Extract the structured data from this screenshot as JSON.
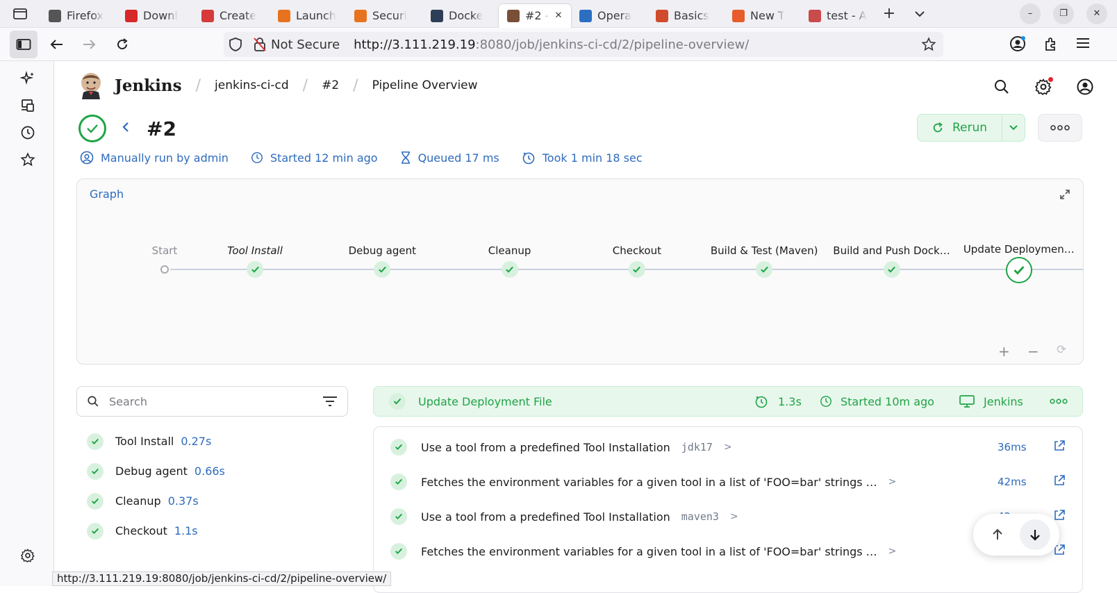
{
  "browser": {
    "tabs": [
      {
        "label": "Firefox",
        "icon": "firefox-view-icon",
        "color": "#555"
      },
      {
        "label": "Downl",
        "icon": "download-icon",
        "color": "#d62828"
      },
      {
        "label": "Create",
        "icon": "create-icon",
        "color": "#d63a3a"
      },
      {
        "label": "Launch",
        "icon": "aws-icon",
        "color": "#e8731f"
      },
      {
        "label": "Securi",
        "icon": "aws-icon",
        "color": "#e8731f"
      },
      {
        "label": "Docke",
        "icon": "docker-icon",
        "color": "#2f3e57"
      },
      {
        "label": "#2 -",
        "icon": "jenkins-icon",
        "color": "#7a4f38",
        "active": true
      },
      {
        "label": "Opera",
        "icon": "operator-icon",
        "color": "#2b6fc2"
      },
      {
        "label": "Basics",
        "icon": "basics-icon",
        "color": "#d04b2b"
      },
      {
        "label": "New T",
        "icon": "firefox-icon",
        "color": "#e65c2a"
      },
      {
        "label": "test - A",
        "icon": "jenkins-test-icon",
        "color": "#c94b4b"
      }
    ],
    "url_security": "Not Secure",
    "url_host": "http://3.111.219.19",
    "url_rest": ":8080/job/jenkins-ci-cd/2/pipeline-overview/",
    "status_url": "http://3.111.219.19:8080/job/jenkins-ci-cd/2/pipeline-overview/"
  },
  "header": {
    "app_name": "Jenkins",
    "breadcrumbs": [
      "jenkins-ci-cd",
      "#2",
      "Pipeline Overview"
    ]
  },
  "run": {
    "title": "#2",
    "rerun_label": "Rerun",
    "meta": {
      "run_by": "Manually run by admin",
      "started": "Started 12 min ago",
      "queued": "Queued 17 ms",
      "took": "Took 1 min 18 sec"
    }
  },
  "graph": {
    "title": "Graph",
    "start_label": "Start",
    "stages": [
      {
        "label": "Tool Install"
      },
      {
        "label": "Debug agent"
      },
      {
        "label": "Cleanup"
      },
      {
        "label": "Checkout"
      },
      {
        "label": "Build & Test (Maven)"
      },
      {
        "label": "Build and Push Dock…"
      },
      {
        "label": "Update Deploymen…",
        "selected": true
      }
    ],
    "zoom_in": "+",
    "zoom_out": "−",
    "reset": "⟳"
  },
  "search": {
    "placeholder": "Search"
  },
  "stage_list": [
    {
      "name": "Tool Install",
      "duration": "0.27s"
    },
    {
      "name": "Debug agent",
      "duration": "0.66s"
    },
    {
      "name": "Cleanup",
      "duration": "0.37s"
    },
    {
      "name": "Checkout",
      "duration": "1.1s"
    }
  ],
  "selected_stage": {
    "name": "Update Deployment File",
    "duration": "1.3s",
    "started": "Started 10m ago",
    "agent": "Jenkins"
  },
  "steps": [
    {
      "text": "Use a tool from a predefined Tool Installation",
      "arg": "jdk17",
      "time": "36ms"
    },
    {
      "text": "Fetches the environment variables for a given tool in a list of 'FOO=bar' strings …",
      "arg": "",
      "time": "42ms"
    },
    {
      "text": "Use a tool from a predefined Tool Installation",
      "arg": "maven3",
      "time": "42ms"
    },
    {
      "text": "Fetches the environment variables for a given tool in a list of 'FOO=bar' strings …",
      "arg": "",
      "time": ""
    }
  ],
  "colors": {
    "success": "#1ea446",
    "link": "#2e6bbd"
  }
}
